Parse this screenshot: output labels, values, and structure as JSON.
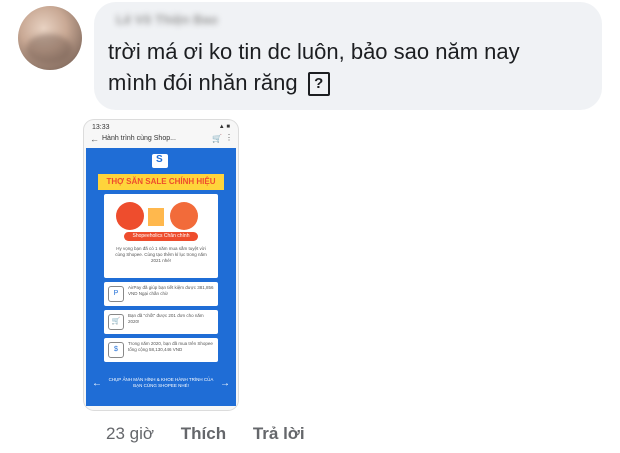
{
  "comment": {
    "author": "Lê Võ Thiện Bao",
    "text_line1": "trời má ơi ko tin dc luôn, bảo sao năm nay",
    "text_line2": "mình đói nhăn răng",
    "emoji_placeholder": "?"
  },
  "attachment": {
    "status_time": "13:33",
    "status_icons": "▲ ■",
    "back_icon": "arrow-left",
    "nav_title": "Hành trình cùng Shop...",
    "cart_icon": "cart",
    "more_icon": "more",
    "banner": "THỢ SĂN SALE CHÍNH HIỆU",
    "badge_label": "Shopeeholics Chân chính",
    "card_text": "Hy vọng bạn đã có 1 năm mua sắm tuyệt vời cùng Shopee. Cùng tạo thêm kỉ lục trong năm 2021 nhé!",
    "rows": [
      {
        "icon": "P",
        "text": "AirPay đã giúp bạn tiết kiệm được 381,856 VND Ngại chần chừ"
      },
      {
        "icon": "🛒",
        "text": "Bạn đã \"chốt\" được 201 đơn cho năm 2020!"
      },
      {
        "icon": "$",
        "text": "Trong năm 2020, bạn đã mua trên Shopee tổng cộng 58,130,446 VND"
      }
    ],
    "footer_text": "CHỤP ẢNH MÀN HÌNH & KHOE HÀNH TRÌNH CỦA BẠN CÙNG SHOPEE NHÉ!",
    "prev_icon": "←",
    "next_icon": "→"
  },
  "actions": {
    "time": "23 giờ",
    "like": "Thích",
    "reply": "Trả lời"
  },
  "colors": {
    "bubble": "#f0f2f5",
    "shopee_blue": "#1f6dd6",
    "shopee_orange": "#ee4d2d",
    "banner_yellow": "#ffd43b"
  }
}
